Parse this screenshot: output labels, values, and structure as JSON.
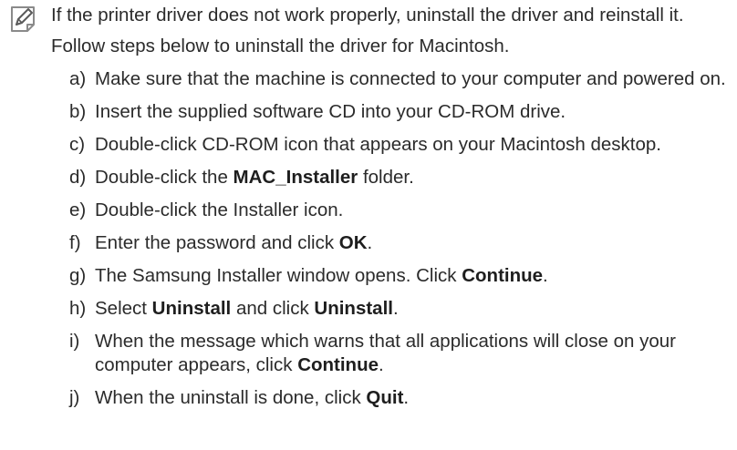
{
  "note": {
    "icon": "note-pencil-icon",
    "intro_line1": "If the printer driver does not work properly, uninstall the driver and reinstall it.",
    "intro_line2": "Follow steps below to uninstall the driver for Macintosh."
  },
  "steps": [
    {
      "marker": "a)",
      "parts": [
        {
          "t": "Make sure that the machine is connected to your computer and powered on."
        }
      ]
    },
    {
      "marker": "b)",
      "parts": [
        {
          "t": "Insert the supplied software CD into your CD-ROM drive."
        }
      ]
    },
    {
      "marker": "c)",
      "parts": [
        {
          "t": "Double-click CD-ROM icon that appears on your Macintosh desktop."
        }
      ]
    },
    {
      "marker": "d)",
      "parts": [
        {
          "t": "Double-click the "
        },
        {
          "t": "MAC_Installer",
          "b": true
        },
        {
          "t": " folder."
        }
      ]
    },
    {
      "marker": "e)",
      "parts": [
        {
          "t": "Double-click the Installer icon."
        }
      ]
    },
    {
      "marker": "f)",
      "parts": [
        {
          "t": "Enter the password and click "
        },
        {
          "t": "OK",
          "b": true
        },
        {
          "t": "."
        }
      ]
    },
    {
      "marker": "g)",
      "parts": [
        {
          "t": "The Samsung Installer window opens. Click "
        },
        {
          "t": "Continue",
          "b": true
        },
        {
          "t": "."
        }
      ]
    },
    {
      "marker": "h)",
      "parts": [
        {
          "t": "Select "
        },
        {
          "t": "Uninstall",
          "b": true
        },
        {
          "t": " and click "
        },
        {
          "t": "Uninstall",
          "b": true
        },
        {
          "t": "."
        }
      ]
    },
    {
      "marker": "i)",
      "parts": [
        {
          "t": "When the message which warns that all applications will close on your computer appears, click "
        },
        {
          "t": "Continue",
          "b": true
        },
        {
          "t": "."
        }
      ]
    },
    {
      "marker": "j)",
      "parts": [
        {
          "t": "When the uninstall is done, click "
        },
        {
          "t": "Quit",
          "b": true
        },
        {
          "t": "."
        }
      ]
    }
  ]
}
